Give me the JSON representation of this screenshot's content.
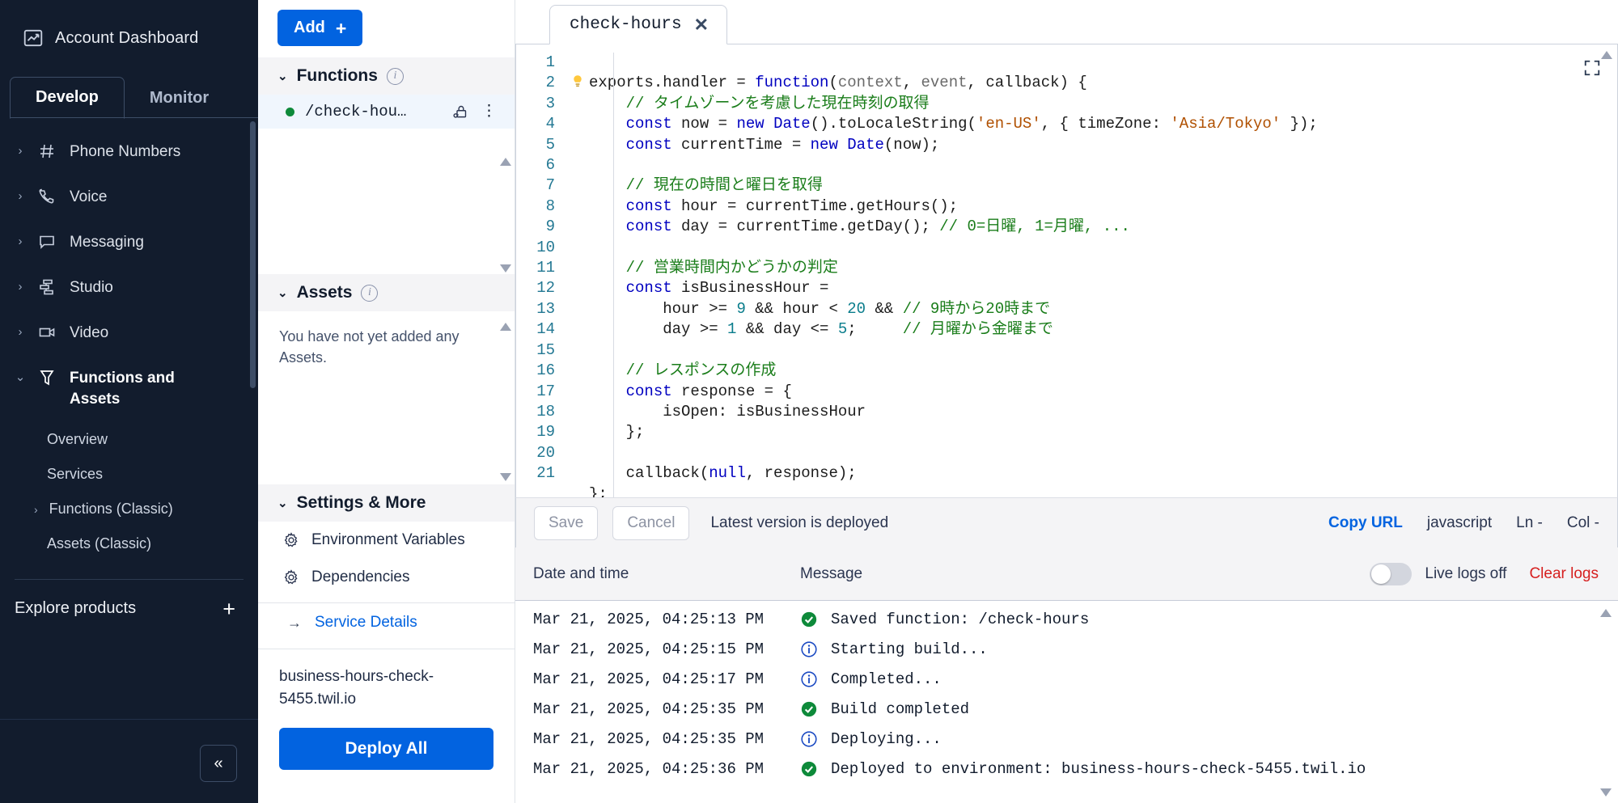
{
  "left_nav": {
    "account_dashboard": "Account Dashboard",
    "account_icon": "dashboard-chart-icon",
    "tabs": [
      {
        "label": "Develop",
        "active": true
      },
      {
        "label": "Monitor",
        "active": false
      }
    ],
    "items": [
      {
        "label": "Phone Numbers",
        "icon": "hash-icon",
        "expanded": false
      },
      {
        "label": "Voice",
        "icon": "phone-icon",
        "expanded": false
      },
      {
        "label": "Messaging",
        "icon": "chat-bubble-icon",
        "expanded": false
      },
      {
        "label": "Studio",
        "icon": "flow-icon",
        "expanded": false
      },
      {
        "label": "Video",
        "icon": "video-camera-icon",
        "expanded": false
      },
      {
        "label": "Functions and Assets",
        "icon": "functions-icon",
        "expanded": true
      }
    ],
    "sub_items": [
      {
        "label": "Overview",
        "has_chevron": false
      },
      {
        "label": "Services",
        "has_chevron": false
      },
      {
        "label": "Functions (Classic)",
        "has_chevron": true
      },
      {
        "label": "Assets (Classic)",
        "has_chevron": false
      }
    ],
    "explore_products": "Explore products",
    "collapse_label": "«"
  },
  "mid_panel": {
    "add_button": "Add",
    "add_plus": "+",
    "functions_section": {
      "title": "Functions",
      "info_icon": "info-icon",
      "items": [
        {
          "name": "/check-hou…",
          "status": "deployed",
          "lock_icon": "lock-icon",
          "menu_icon": "kebab-menu-icon"
        }
      ]
    },
    "assets_section": {
      "title": "Assets",
      "info_icon": "info-icon",
      "empty_text": "You have not yet added any Assets."
    },
    "settings_section": {
      "title": "Settings & More",
      "items": [
        {
          "label": "Environment Variables",
          "icon": "gear-icon"
        },
        {
          "label": "Dependencies",
          "icon": "gear-icon"
        }
      ],
      "service_details": "Service Details",
      "service_details_icon": "arrow-right-icon"
    },
    "domain": "business-hours-check-5455.twil.io",
    "deploy_all": "Deploy All"
  },
  "editor": {
    "tab": {
      "name": "check-hours",
      "close_icon": "close-icon"
    },
    "expand_icon": "expand-icon",
    "bulb_icon": "lightbulb-icon",
    "line_numbers": [
      1,
      2,
      3,
      4,
      5,
      6,
      7,
      8,
      9,
      10,
      11,
      12,
      13,
      14,
      15,
      16,
      17,
      18,
      19,
      20,
      21
    ],
    "lines": [
      "exports.handler = function(context, event, callback) {",
      "    // タイムゾーンを考慮した現在時刻の取得",
      "    const now = new Date().toLocaleString('en-US', { timeZone: 'Asia/Tokyo' });",
      "    const currentTime = new Date(now);",
      "",
      "    // 現在の時間と曜日を取得",
      "    const hour = currentTime.getHours();",
      "    const day = currentTime.getDay(); // 0=日曜, 1=月曜, ...",
      "",
      "    // 営業時間内かどうかの判定",
      "    const isBusinessHour =",
      "        hour >= 9 && hour < 20 && // 9時から20時まで",
      "        day >= 1 && day <= 5;     // 月曜から金曜まで",
      "",
      "    // レスポンスの作成",
      "    const response = {",
      "        isOpen: isBusinessHour",
      "    };",
      "",
      "    callback(null, response);",
      "};"
    ]
  },
  "save_bar": {
    "save": "Save",
    "cancel": "Cancel",
    "status": "Latest version is deployed",
    "copy_url": "Copy URL",
    "language": "javascript",
    "line_indicator": "Ln -",
    "col_indicator": "Col -"
  },
  "logs": {
    "col_date": "Date and time",
    "col_message": "Message",
    "live_logs_label": "Live logs off",
    "live_logs_on": false,
    "clear_logs": "Clear logs",
    "rows": [
      {
        "date": "Mar 21, 2025, 04:25:13 PM",
        "level": "success",
        "message": "Saved function: /check-hours"
      },
      {
        "date": "Mar 21, 2025, 04:25:15 PM",
        "level": "info",
        "message": "Starting build..."
      },
      {
        "date": "Mar 21, 2025, 04:25:17 PM",
        "level": "info",
        "message": "Completed..."
      },
      {
        "date": "Mar 21, 2025, 04:25:35 PM",
        "level": "success",
        "message": "Build completed"
      },
      {
        "date": "Mar 21, 2025, 04:25:35 PM",
        "level": "info",
        "message": "Deploying..."
      },
      {
        "date": "Mar 21, 2025, 04:25:36 PM",
        "level": "success",
        "message": "Deployed to environment: business-hours-check-5455.twil.io"
      }
    ]
  },
  "colors": {
    "nav_bg": "#121c2d",
    "accent_blue": "#0263e0",
    "success_green": "#0e8a3a",
    "error_red": "#d61f1f",
    "panel_grey": "#f4f4f6"
  }
}
